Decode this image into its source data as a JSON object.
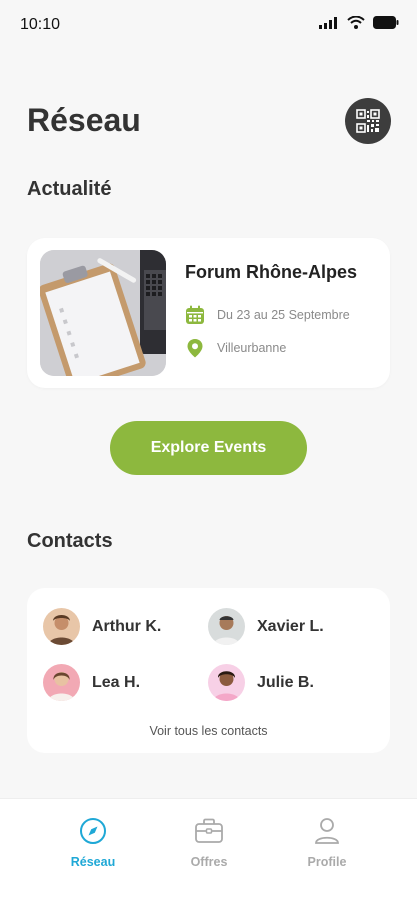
{
  "status_bar": {
    "time": "10:10"
  },
  "header": {
    "title": "Réseau",
    "qr_icon": "qr-code-icon"
  },
  "news": {
    "section_title": "Actualité",
    "event": {
      "title": "Forum Rhône-Alpes",
      "date": "Du 23 au 25 Septembre",
      "location": "Villeurbanne",
      "date_icon": "calendar-icon",
      "location_icon": "location-pin-icon"
    },
    "explore_label": "Explore Events"
  },
  "contacts": {
    "section_title": "Contacts",
    "items": [
      {
        "name": "Arthur K."
      },
      {
        "name": "Xavier L."
      },
      {
        "name": "Lea H."
      },
      {
        "name": "Julie B."
      }
    ],
    "see_all": "Voir tous les contacts"
  },
  "nav": {
    "items": [
      {
        "label": "Réseau",
        "icon": "compass-icon",
        "active": true
      },
      {
        "label": "Offres",
        "icon": "briefcase-icon",
        "active": false
      },
      {
        "label": "Profile",
        "icon": "user-icon",
        "active": false
      }
    ]
  },
  "colors": {
    "accent_green": "#8db83e",
    "accent_blue": "#1fa8d6",
    "dark": "#3d3d3d"
  }
}
